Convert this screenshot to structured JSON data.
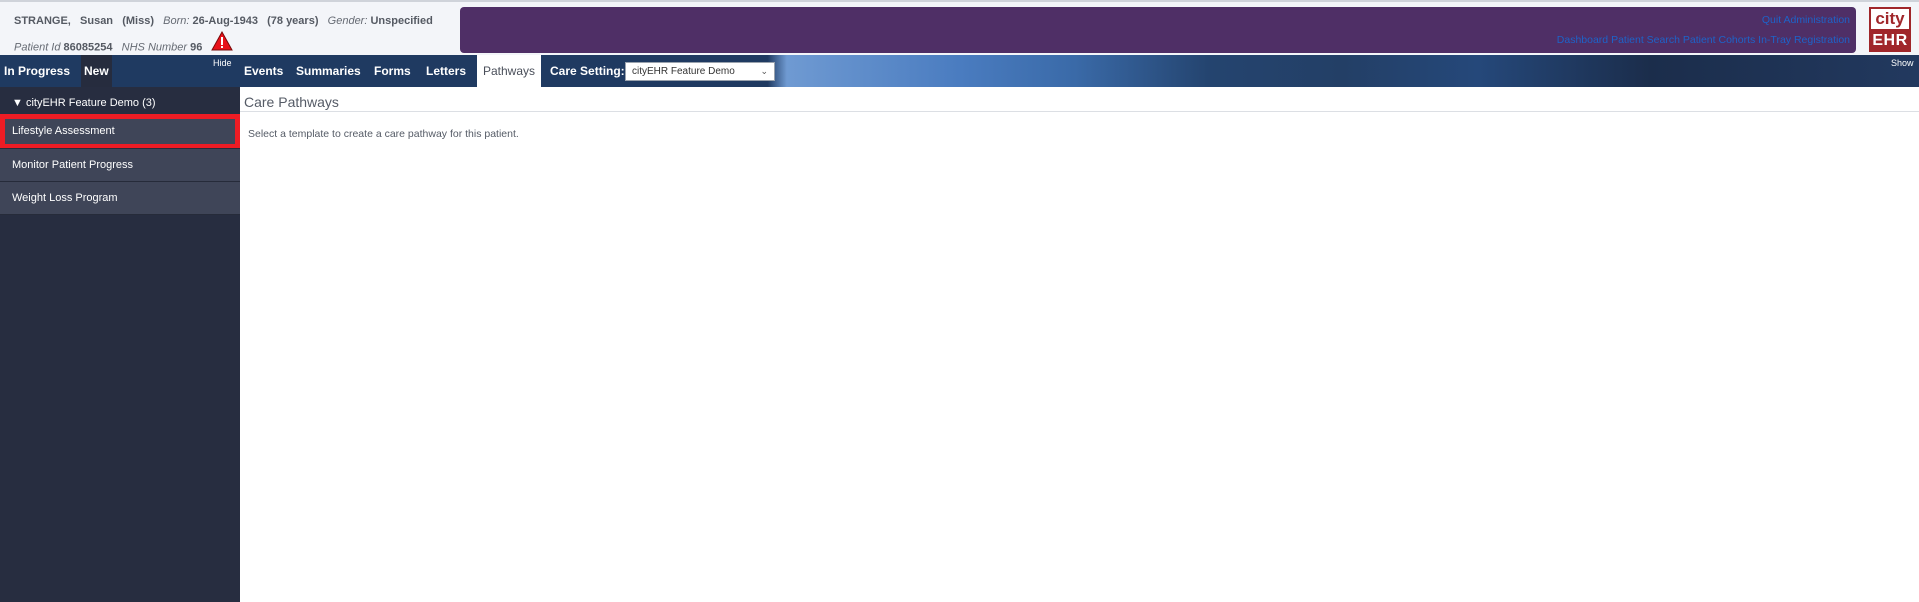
{
  "patient": {
    "surname": "STRANGE,",
    "given_name": "Susan",
    "title": "(Miss)",
    "born_label": "Born:",
    "born_value": "26-Aug-1943",
    "age": "(78 years)",
    "gender_label": "Gender:",
    "gender_value": "Unspecified",
    "patient_id_label": "Patient Id",
    "patient_id_value": "86085254",
    "nhs_label": "NHS Number",
    "nhs_value": "96",
    "alert_icon": "warning-triangle-icon"
  },
  "admin": {
    "quit_label": "Quit Administration",
    "links": [
      "Dashboard",
      "Patient Search",
      "Patient Cohorts",
      "In-Tray",
      "Registration"
    ],
    "panel_color": "#4f2f66"
  },
  "logo": {
    "top": "city",
    "bottom": "EHR",
    "color": "#a0262a"
  },
  "nav": {
    "in_progress": "In Progress",
    "new": "New",
    "hide": "Hide",
    "show": "Show",
    "tabs": [
      "Events",
      "Summaries",
      "Forms",
      "Letters",
      "Pathways"
    ],
    "active_tab": "Pathways",
    "care_setting_label": "Care Setting:",
    "care_setting_value": "cityEHR Feature Demo"
  },
  "sidebar": {
    "group_label": "▼ cityEHR Feature Demo (3)",
    "items": [
      {
        "label": "Lifestyle Assessment",
        "highlighted": true
      },
      {
        "label": "Monitor Patient Progress"
      },
      {
        "label": "Weight Loss Program"
      }
    ],
    "highlight_color": "#ed1c24"
  },
  "content": {
    "title": "Care Pathways",
    "message": "Select a template to create a care pathway for this patient."
  }
}
